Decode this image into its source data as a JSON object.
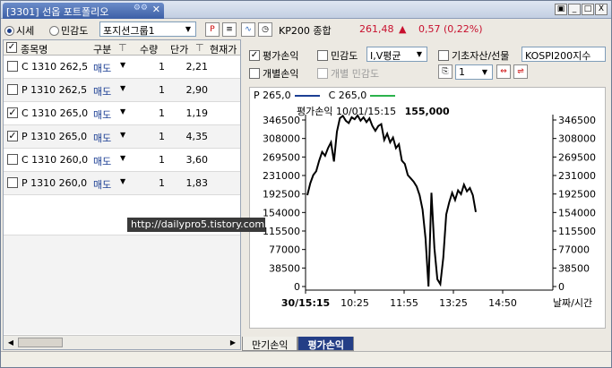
{
  "window": {
    "tab_title": "[3301] 선옵 포트폴리오",
    "tab_icons": "⚙⚙",
    "close": "✕",
    "btn_restore": "▣",
    "btn_min": "_",
    "btn_max": "□",
    "btn_close": "X"
  },
  "toolbar": {
    "radio_market": "시세",
    "radio_sensitivity": "민감도",
    "group_select": "포지션그룹1",
    "kp_label": "KP200 종합",
    "kp_value": "261,48",
    "kp_arrow": "▲",
    "kp_change": "0,57 (0,22%)"
  },
  "table": {
    "headers": [
      "종목명",
      "구분",
      "수량",
      "단가",
      "현재가"
    ],
    "rows": [
      {
        "checked": false,
        "name": "C 1310 262,5",
        "type": "매도",
        "qty": "1",
        "price": "2,21"
      },
      {
        "checked": false,
        "name": "P 1310 262,5",
        "type": "매도",
        "qty": "1",
        "price": "2,90"
      },
      {
        "checked": true,
        "name": "C 1310 265,0",
        "type": "매도",
        "qty": "1",
        "price": "1,19"
      },
      {
        "checked": true,
        "name": "P 1310 265,0",
        "type": "매도",
        "qty": "1",
        "price": "4,35"
      },
      {
        "checked": false,
        "name": "C 1310 260,0",
        "type": "매도",
        "qty": "1",
        "price": "3,60"
      },
      {
        "checked": false,
        "name": "P 1310 260,0",
        "type": "매도",
        "qty": "1",
        "price": "1,83"
      }
    ]
  },
  "options": {
    "eval_pnl": "평가손익",
    "sensitivity": "민감도",
    "iv_select": "I,V평균",
    "underlying_label": "기초자산/선물",
    "underlying_value": "KOSPI200지수",
    "individual_pnl": "개별손익",
    "individual_sensitivity": "개별 민감도",
    "small_select": "1"
  },
  "chart_data": {
    "type": "line",
    "title": "평가손익 10/01/15:15",
    "title_value": "155,000",
    "legend": [
      {
        "name": "P 265,0",
        "color": "#1c3f94"
      },
      {
        "name": "C 265,0",
        "color": "#2bb24c"
      }
    ],
    "x_ticks": [
      "30/15:15",
      "10:25",
      "11:55",
      "13:25",
      "14:50"
    ],
    "x_label": "날짜/시간",
    "y_ticks": [
      "346500",
      "308000",
      "269500",
      "231000",
      "192500",
      "154000",
      "115500",
      "77000",
      "38500",
      "0"
    ],
    "ylim": [
      0,
      346500
    ],
    "series": [
      {
        "values": [
          190000,
          215000,
          232000,
          240000,
          262000,
          280000,
          272000,
          288000,
          300000,
          260000,
          322000,
          350000,
          355000,
          345000,
          340000,
          352000,
          348000,
          356000,
          345000,
          352000,
          342000,
          350000,
          334000,
          324000,
          334000,
          338000,
          305000,
          318000,
          300000,
          310000,
          288000,
          296000,
          262000,
          255000,
          232000,
          225000,
          218000,
          208000,
          190000,
          160000,
          100000,
          0,
          195000,
          80000,
          15000,
          5000,
          60000,
          150000,
          175000,
          195000,
          180000,
          200000,
          192000,
          212000,
          198000,
          205000,
          190000,
          155000
        ]
      }
    ]
  },
  "bottom_tabs": [
    "만기손익",
    "평가손익"
  ],
  "watermark": "http://dailypro5.tistory.com"
}
